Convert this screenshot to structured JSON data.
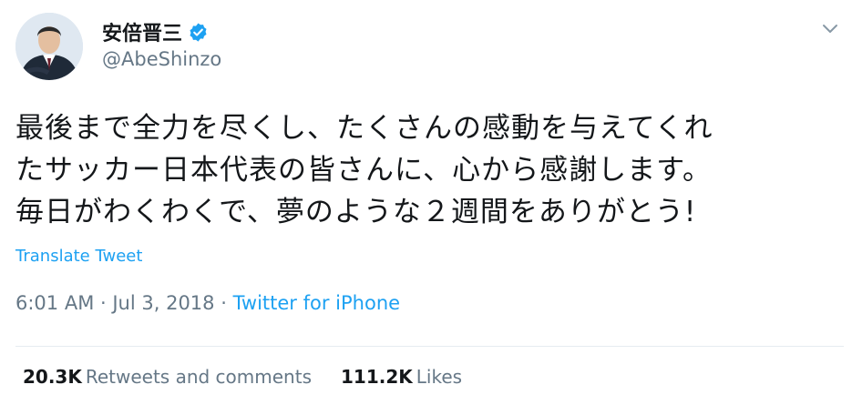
{
  "user": {
    "display_name": "安倍晋三",
    "handle": "@AbeShinzo",
    "verified_icon": "verified-badge-icon"
  },
  "tweet": {
    "lines": [
      "最後まで全力を尽くし、たくさんの感動を与えてくれ",
      "たサッカー日本代表の皆さんに、心から感謝します。",
      "毎日がわくわくで、夢のような２週間をありがとう!"
    ],
    "translate_label": "Translate Tweet"
  },
  "meta": {
    "time": "6:01 AM",
    "sep1": " · ",
    "date": "Jul 3, 2018",
    "sep2": " · ",
    "source": "Twitter for iPhone"
  },
  "stats": {
    "retweets_count": "20.3K",
    "retweets_label": "Retweets and comments",
    "likes_count": "111.2K",
    "likes_label": "Likes"
  },
  "colors": {
    "accent": "#1da1f2",
    "secondary_text": "#657786",
    "primary_text": "#14171a",
    "divider": "#e6ecf0"
  }
}
